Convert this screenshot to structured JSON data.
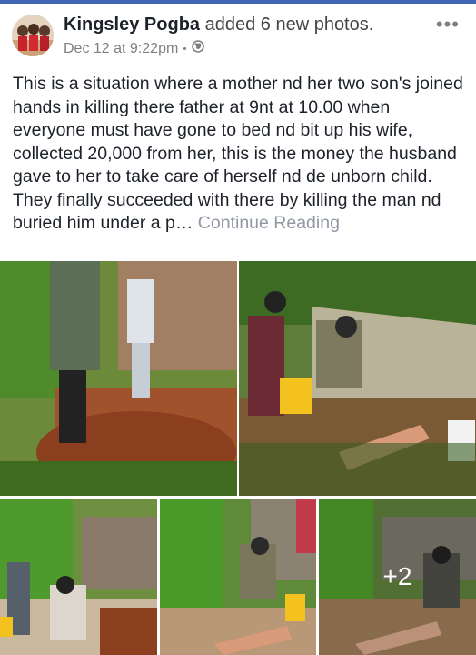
{
  "post": {
    "author": "Kingsley Pogba",
    "action": "added 6 new photos.",
    "timestamp": "Dec 12 at 9:22pm",
    "audience_icon": "globe-icon",
    "options_icon": "more-options-icon",
    "text": "This is a situation where a mother nd her two son's joined hands in killing there father at 9nt at 10.00 when everyone must have gone to bed nd bit up his wife, collected 20,000 from her, this is the money the husband gave to her to take care of herself nd de unborn child. They finally succeeded with there by killing the man nd buried him under a p…",
    "see_more": "Continue Reading",
    "more_photos": "+2"
  },
  "colors": {
    "brand_blue": "#4267b2",
    "text_primary": "#1d2129",
    "text_secondary": "#7f7f7f",
    "link_muted": "#9197a3"
  }
}
